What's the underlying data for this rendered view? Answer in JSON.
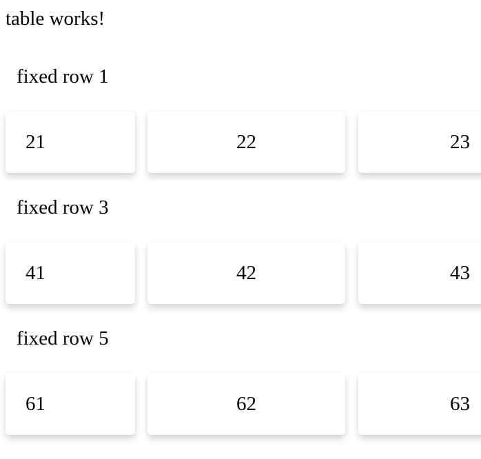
{
  "heading": "table works!",
  "fixed_rows": [
    "fixed row 1",
    "fixed row 3",
    "fixed row 5"
  ],
  "data_rows": [
    [
      "21",
      "22",
      "23"
    ],
    [
      "41",
      "42",
      "43"
    ],
    [
      "61",
      "62",
      "63"
    ]
  ]
}
